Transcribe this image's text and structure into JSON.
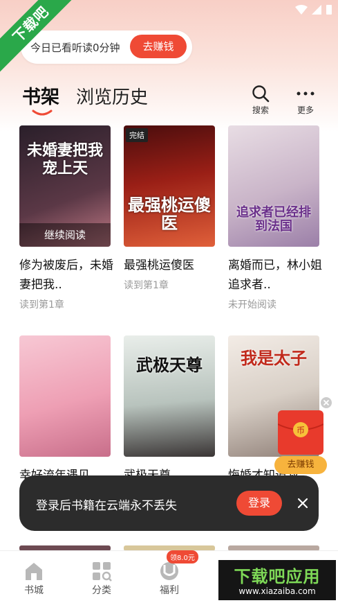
{
  "watermark": {
    "ribbon": "下载吧",
    "corner_title": "下载吧应用",
    "corner_url": "www.xiazaiba.com"
  },
  "daily": {
    "text": "今日已看听读0分钟",
    "earn_button": "去赚钱"
  },
  "header": {
    "tab_active": "书架",
    "tab_other": "浏览历史",
    "search_label": "搜索",
    "more_label": "更多"
  },
  "books": [
    {
      "cover_title": "未婚妻把我宠上天",
      "cover_bg": "#3a2a35",
      "overlay": "继续阅读",
      "title": "修为被废后，未婚妻把我..",
      "progress": "读到第1章"
    },
    {
      "cover_title": "最强桃运傻医",
      "cover_bg": "#8a1a14",
      "badge": "完结",
      "title": "最强桃运傻医",
      "progress": "读到第1章"
    },
    {
      "cover_title": "追求者已经排到法国",
      "cover_bg": "#d8c8d6",
      "title": "离婚而已，林小姐追求者..",
      "progress": "未开始阅读"
    },
    {
      "cover_title": "",
      "cover_bg": "#f2b6c4",
      "title": "幸好流年遇见",
      "progress": ""
    },
    {
      "cover_title": "武极天尊",
      "cover_bg": "#cfd7d2",
      "title": "武极天尊",
      "progress": ""
    },
    {
      "cover_title": "我是太子",
      "cover_bg": "#e6dcd2",
      "title": "悔婚才知道我",
      "progress": ""
    }
  ],
  "toast": {
    "message": "登录后书籍在云端永不丢失",
    "login_button": "登录"
  },
  "red_packet": {
    "label": "去赚钱"
  },
  "bottom_nav": {
    "items": [
      {
        "label": "书城",
        "icon": "home-icon"
      },
      {
        "label": "分类",
        "icon": "category-icon"
      },
      {
        "label": "福利",
        "icon": "welfare-icon"
      }
    ],
    "welfare_badge": "领8.0元"
  },
  "colors": {
    "accent": "#ef4a35",
    "toast_bg": "#2c2c2c",
    "ribbon": "#2aa84a"
  }
}
